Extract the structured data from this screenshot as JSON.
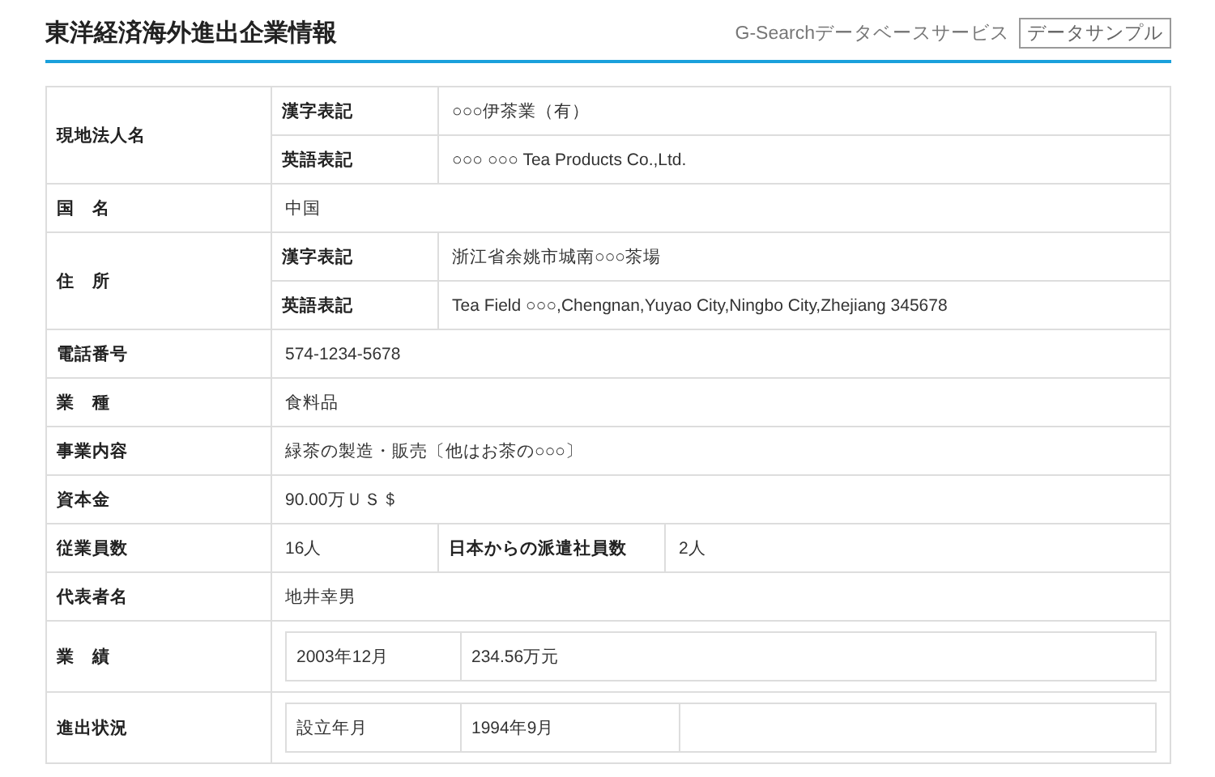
{
  "header": {
    "title": "東洋経済海外進出企業情報",
    "service": "G-Searchデータベースサービス",
    "badge": "データサンプル"
  },
  "rows": [
    {
      "kind": "sub",
      "label": "現地法人名",
      "subs": [
        {
          "label": "漢字表記",
          "value": "○○○伊茶業（有）"
        },
        {
          "label": "英語表記",
          "value": "○○○ ○○○ Tea Products Co.,Ltd."
        }
      ]
    },
    {
      "kind": "plain",
      "label": "国　名",
      "value": "中国"
    },
    {
      "kind": "sub",
      "label": "住　所",
      "subs": [
        {
          "label": "漢字表記",
          "value": "浙江省余姚市城南○○○茶場"
        },
        {
          "label": "英語表記",
          "value": "Tea Field ○○○,Chengnan,Yuyao City,Ningbo City,Zhejiang 345678"
        }
      ]
    },
    {
      "kind": "plain",
      "label": "電話番号",
      "value": "574-1234-5678"
    },
    {
      "kind": "plain",
      "label": "業　種",
      "value": "食料品"
    },
    {
      "kind": "plain",
      "label": "事業内容",
      "value": "緑茶の製造・販売〔他はお茶の○○○〕"
    },
    {
      "kind": "plain",
      "label": "資本金",
      "value": "90.00万ＵＳ＄"
    },
    {
      "kind": "pair",
      "label": "従業員数",
      "value": "16人",
      "label2": "日本からの派遣社員数",
      "value2": "2人"
    },
    {
      "kind": "plain",
      "label": "代表者名",
      "value": "地井幸男"
    },
    {
      "kind": "nested",
      "label": "業　績",
      "cells": [
        "2003年12月",
        "234.56万元"
      ],
      "trailing_blank": false
    },
    {
      "kind": "nested",
      "label": "進出状況",
      "cells": [
        "設立年月",
        "1994年9月"
      ],
      "trailing_blank": true
    }
  ]
}
